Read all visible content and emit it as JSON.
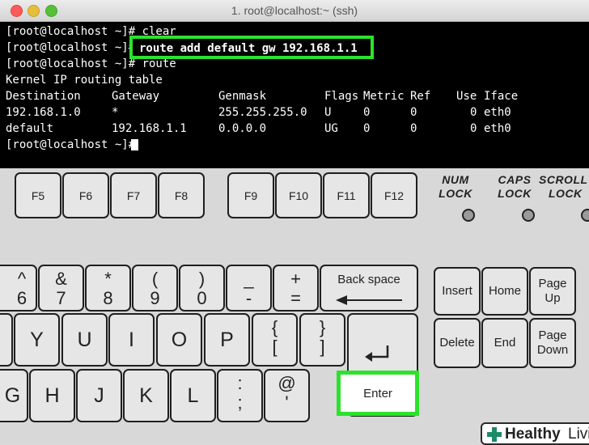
{
  "window": {
    "title": "1. root@localhost:~ (ssh)",
    "traffic_lights": {
      "close": "#fc5b57",
      "minimize": "#e5bf3c",
      "zoom": "#57c038"
    }
  },
  "terminal": {
    "lines": [
      "[root@localhost ~]# clear",
      "[root@localhost ~]# ",
      "[root@localhost ~]# route",
      "Kernel IP routing table"
    ],
    "highlighted_command": "route add default gw 192.168.1.1",
    "table": {
      "headers": [
        "Destination",
        "Gateway",
        "Genmask",
        "Flags",
        "Metric",
        "Ref",
        "Use",
        "Iface"
      ],
      "rows": [
        [
          "192.168.1.0",
          "*",
          "255.255.255.0",
          "U",
          "0",
          "0",
          "0",
          "eth0"
        ],
        [
          "default",
          "192.168.1.1",
          "0.0.0.0",
          "UG",
          "0",
          "0",
          "0",
          "eth0"
        ]
      ]
    },
    "final_prompt": "[root@localhost ~]#",
    "highlight_color": "#2ce22c"
  },
  "keyboard": {
    "function_keys": [
      "F5",
      "F6",
      "F7",
      "F8",
      "F9",
      "F10",
      "F11",
      "F12"
    ],
    "lock_labels": [
      {
        "top": "NUM",
        "bottom": "LOCK"
      },
      {
        "top": "CAPS",
        "bottom": "LOCK"
      },
      {
        "top": "SCROLL",
        "bottom": "LOCK"
      }
    ],
    "number_row": [
      {
        "top": "^",
        "bottom": "6"
      },
      {
        "top": "&",
        "bottom": "7"
      },
      {
        "top": "*",
        "bottom": "8"
      },
      {
        "top": "(",
        "bottom": "9"
      },
      {
        "top": ")",
        "bottom": "0"
      },
      {
        "top": "_",
        "bottom": "-"
      },
      {
        "top": "+",
        "bottom": "="
      }
    ],
    "backspace_label": "Back space",
    "letters_row1": [
      "Y",
      "U",
      "I",
      "O",
      "P"
    ],
    "bracket_keys": [
      {
        "top": "{",
        "bottom": "["
      },
      {
        "top": "}",
        "bottom": "]"
      }
    ],
    "letters_row2": [
      "G",
      "H",
      "J",
      "K",
      "L"
    ],
    "colon_key": {
      "top": ":",
      "bottom": ";"
    },
    "quote_key": {
      "top": "@",
      "bottom": "'"
    },
    "enter_label": "Enter",
    "nav_keys": [
      "Insert",
      "Home",
      "Page Up",
      "Delete",
      "End",
      "Page Down"
    ]
  },
  "watermark": {
    "brand": "Healthy",
    "suffix": "Living"
  }
}
